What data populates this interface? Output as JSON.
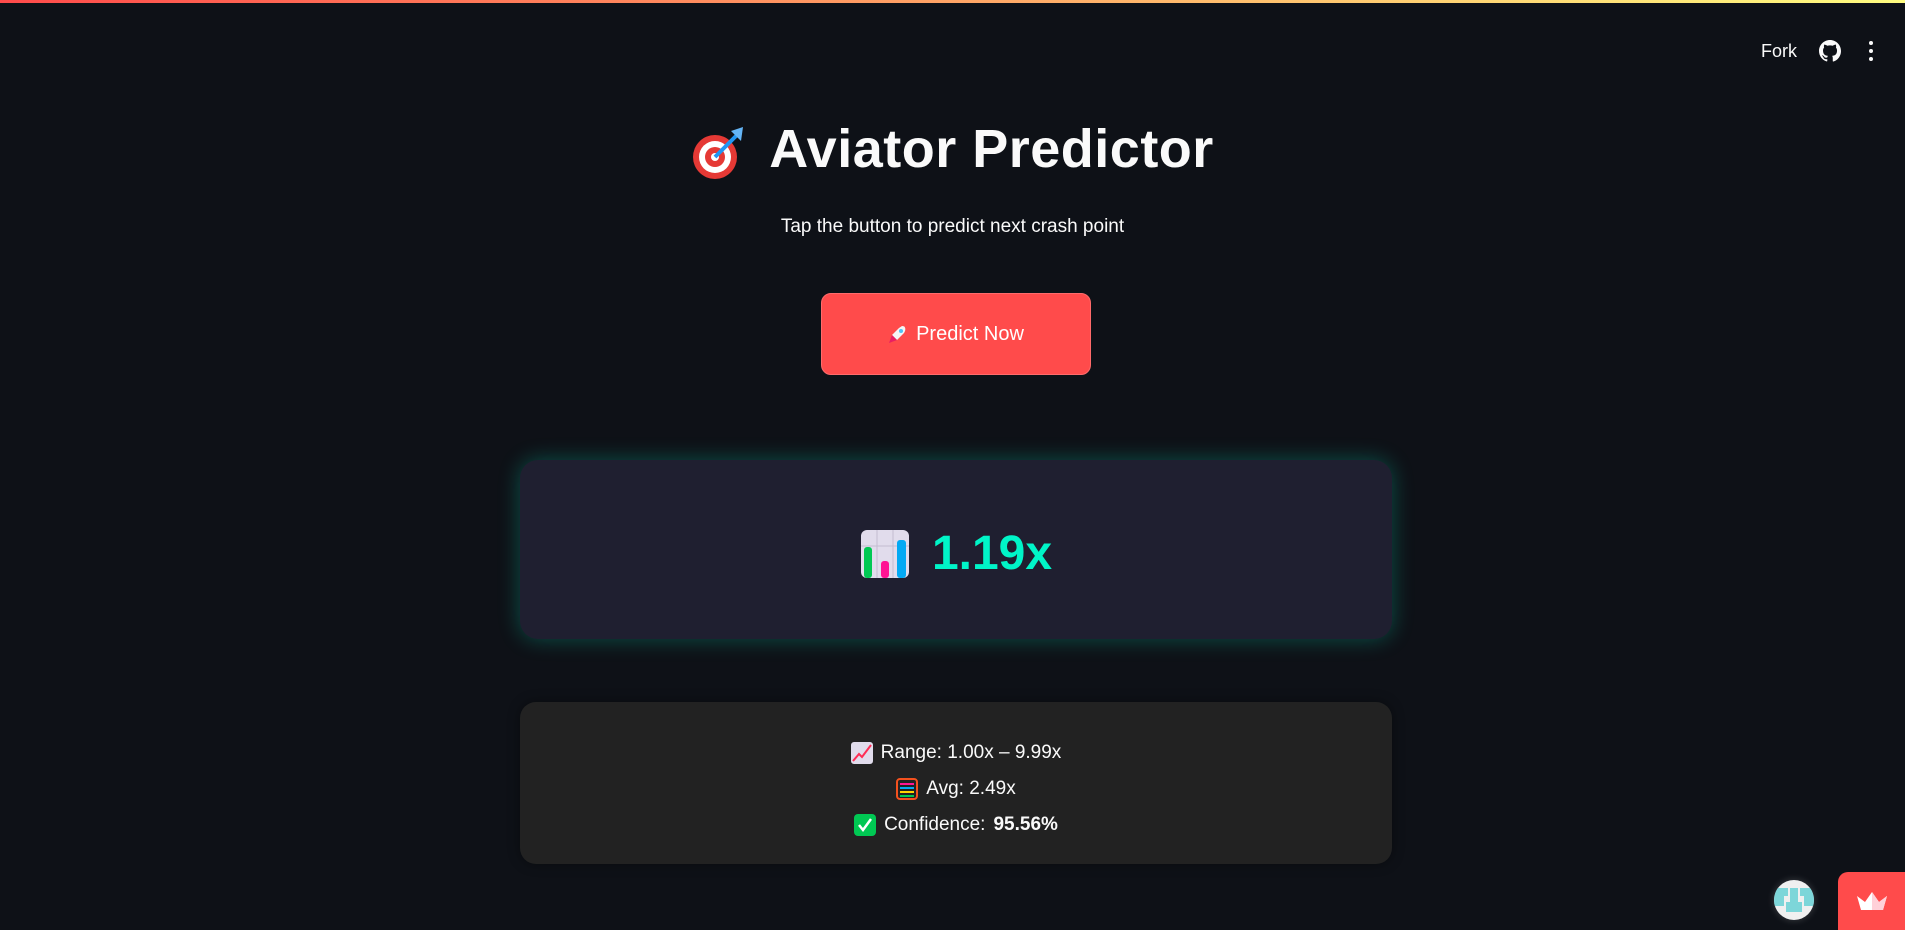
{
  "header": {
    "fork_label": "Fork",
    "github_icon": "github-icon",
    "menu_icon": "kebab-menu-icon"
  },
  "title": {
    "icon": "direct-hit-target-emoji",
    "text": "Aviator Predictor"
  },
  "subtitle": "Tap the button to predict next crash point",
  "predict_button": {
    "icon": "rocket-emoji",
    "label": "Predict Now",
    "color": "#ff4b4b"
  },
  "result": {
    "icon": "bar-chart-emoji",
    "value": "1.19x",
    "color": "#00f5c8"
  },
  "stats": {
    "range": {
      "icon": "chart-increasing-emoji",
      "label": "Range: 1.00x – 9.99x"
    },
    "avg": {
      "icon": "abacus-emoji",
      "label": "Avg: 2.49x"
    },
    "confidence": {
      "icon": "check-mark-button-emoji",
      "label": "Confidence:",
      "value": "95.56%"
    }
  },
  "footer": {
    "avatar_icon": "user-avatar",
    "badge_icon": "streamlit-crown-icon"
  }
}
